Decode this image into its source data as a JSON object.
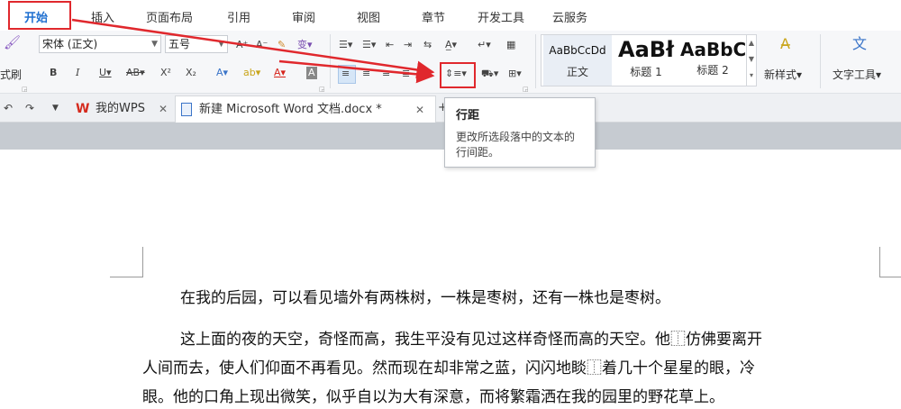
{
  "menu": {
    "tabs": [
      "开始",
      "插入",
      "页面布局",
      "引用",
      "审阅",
      "视图",
      "章节",
      "开发工具",
      "云服务"
    ],
    "active": "开始"
  },
  "ribbon": {
    "font_name": "宋体 (正文)",
    "font_size": "五号",
    "format_painter_label": "式刷",
    "styles": [
      {
        "sample": "AaBbCcDd",
        "name": "正文"
      },
      {
        "sample": "AaBł",
        "name": "标题 1"
      },
      {
        "sample": "AaBbC",
        "name": "标题 2"
      }
    ],
    "new_style_label": "新样式",
    "text_tools_label": "文字工具"
  },
  "quick_access": {
    "wps_tab": "我的WPS",
    "doc_tab": "新建 Microsoft Word 文档.docx *"
  },
  "tooltip": {
    "title": "行距",
    "description": "更改所选段落中的文本的行间距。"
  },
  "document": {
    "para1": "在我的后园，可以看见墙外有两株树，一株是枣树，还有一株也是枣树。",
    "para2_line1": "这上面的夜的天空，奇怪而高，我生平没有见过这样奇怪而高的天空。他⿰仿佛要离开",
    "para2_line2": "人间而去，使人们仰面不再看见。然而现在却非常之蓝，闪闪地睒⿰着几十个星星的眼，冷",
    "para2_line3": "眼。他的口角上现出微笑，似乎自以为大有深意，而将繁霜洒在我的园里的野花草上。"
  },
  "colors": {
    "accent": "#1e6fd0",
    "highlight_red": "#e0282d",
    "wps_red": "#d52b1e"
  }
}
